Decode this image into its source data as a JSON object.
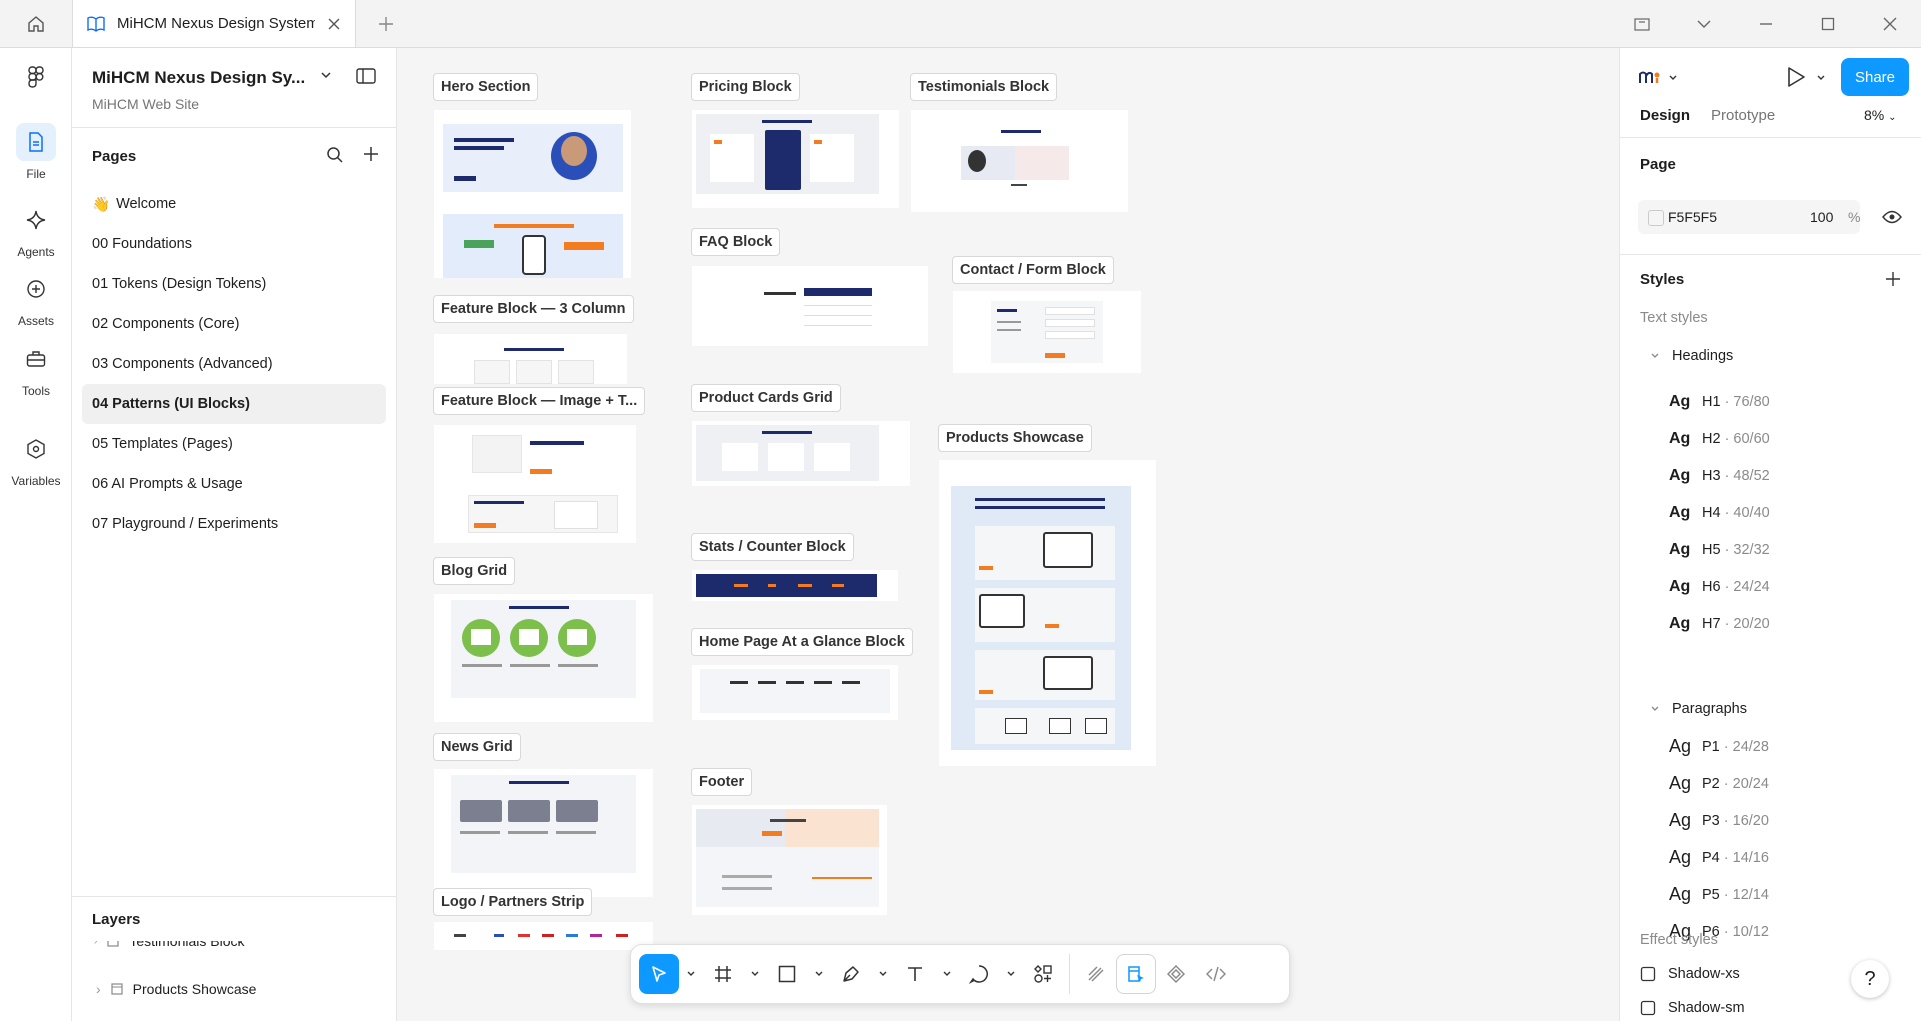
{
  "titlebar": {
    "tab_title": "MiHCM Nexus Design System"
  },
  "rail": {
    "file": "File",
    "agents": "Agents",
    "assets": "Assets",
    "tools": "Tools",
    "variables": "Variables"
  },
  "file": {
    "name": "MiHCM Nexus Design Sy...",
    "project": "MiHCM Web Site"
  },
  "pages": {
    "heading": "Pages",
    "items": [
      {
        "label": "Welcome",
        "emoji": "👋"
      },
      {
        "label": "00 Foundations"
      },
      {
        "label": "01 Tokens (Design Tokens)"
      },
      {
        "label": "02 Components (Core)"
      },
      {
        "label": "03 Components (Advanced)"
      },
      {
        "label": "04 Patterns (UI Blocks)"
      },
      {
        "label": "05 Templates (Pages)"
      },
      {
        "label": "06 AI Prompts & Usage"
      },
      {
        "label": "07 Playground / Experiments"
      }
    ]
  },
  "layers": {
    "heading": "Layers",
    "items": [
      "Testimonials Block",
      "Products Showcase"
    ]
  },
  "canvas": {
    "frames": {
      "hero": "Hero Section",
      "feature3": "Feature Block — 3 Column",
      "featureimg": "Feature Block — Image + T...",
      "blog": "Blog Grid",
      "news": "News Grid",
      "logo": "Logo / Partners Strip",
      "pricing": "Pricing Block",
      "faq": "FAQ Block",
      "productcards": "Product Cards Grid",
      "stats": "Stats / Counter Block",
      "homepage": "Home Page At a Glance Block",
      "footer": "Footer",
      "testimonials": "Testimonials Block",
      "contact": "Contact / Form Block",
      "productsshow": "Products Showcase"
    }
  },
  "rightpanel": {
    "share": "Share",
    "tab_design": "Design",
    "tab_prototype": "Prototype",
    "zoom": "8%",
    "page_heading": "Page",
    "page_color": "F5F5F5",
    "page_opacity": "100",
    "percent": "%",
    "styles_heading": "Styles",
    "text_styles": "Text styles",
    "headings_group": "Headings",
    "paragraphs_group": "Paragraphs",
    "ag": "Ag",
    "headings": [
      {
        "name": "H1",
        "size": " · 76/80"
      },
      {
        "name": "H2",
        "size": " · 60/60"
      },
      {
        "name": "H3",
        "size": " · 48/52"
      },
      {
        "name": "H4",
        "size": " · 40/40"
      },
      {
        "name": "H5",
        "size": " · 32/32"
      },
      {
        "name": "H6",
        "size": " · 24/24"
      },
      {
        "name": "H7",
        "size": " · 20/20"
      }
    ],
    "paragraphs": [
      {
        "name": "P1",
        "size": " · 24/28"
      },
      {
        "name": "P2",
        "size": " · 20/24"
      },
      {
        "name": "P3",
        "size": " · 16/20"
      },
      {
        "name": "P4",
        "size": " · 14/16"
      },
      {
        "name": "P5",
        "size": " · 12/14"
      },
      {
        "name": "P6",
        "size": " · 10/12"
      }
    ],
    "effect_styles": "Effect styles",
    "effects": [
      "Shadow-xs",
      "Shadow-sm"
    ],
    "help": "?"
  },
  "colors": {
    "accent": "#0d99ff",
    "orange": "#f47c20",
    "navy": "#1d2a6b"
  }
}
